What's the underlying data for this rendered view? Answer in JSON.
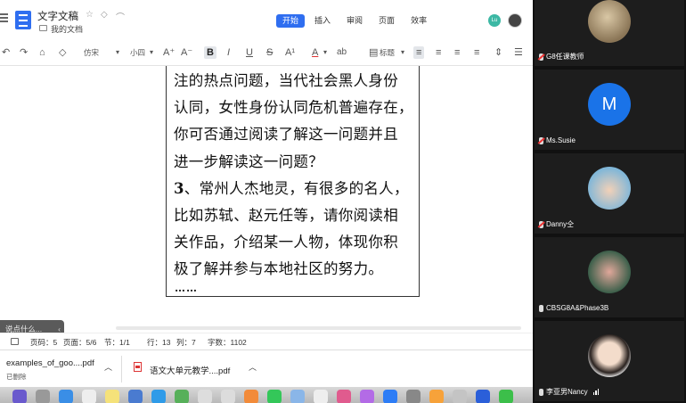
{
  "doc": {
    "title": "文字文稿",
    "breadcrumb": "我的文档",
    "menu_tabs": [
      "开始",
      "插入",
      "审阅",
      "页面",
      "效率"
    ],
    "active_tab": 0,
    "collaborator_initials": "Lu"
  },
  "toolbar": {
    "font_name": "仿宋",
    "font_size": "小四",
    "bold": "B",
    "italic": "I",
    "underline": "U",
    "strike": "S",
    "superscript": "A¹",
    "font_color": "A",
    "highlight": "ab",
    "style_label": "标题"
  },
  "content": {
    "lines": [
      "注的热点问题，当代社会黑人身份",
      "认同，女性身份认同危机普遍存在，",
      "你可否通过阅读了解这一问题并且",
      "进一步解读这一问题？",
      "、常州人杰地灵，有很多的名人，",
      "比如苏轼、赵元任等，请你阅读相",
      "关作品，介绍某一人物，体现你积",
      "极了解并参与本地社区的努力。"
    ],
    "item_number": "3",
    "ellipsis": "……"
  },
  "ime_hint": "说点什么...",
  "status": {
    "page_code": "页码：5",
    "page": "页面：5/6",
    "section": "节：1/1",
    "row": "行：13",
    "col": "列：7",
    "word_count": "字数：1102"
  },
  "downloads": [
    {
      "name": "examples_of_goo....pdf",
      "status": "已删除"
    },
    {
      "name": "语文大单元教学....pdf"
    }
  ],
  "participants": [
    {
      "name": "G8任课教师",
      "muted": true
    },
    {
      "name": "Ms.Susie",
      "muted": true,
      "initial": "M"
    },
    {
      "name": "Danny仝",
      "muted": true
    },
    {
      "name": "CBSG8A&Phase3B",
      "muted": false
    },
    {
      "name": "李亚男Nancy",
      "muted": false
    }
  ],
  "colors": {
    "accent": "#2f6ef0",
    "participant_m": "#1a73e8"
  }
}
